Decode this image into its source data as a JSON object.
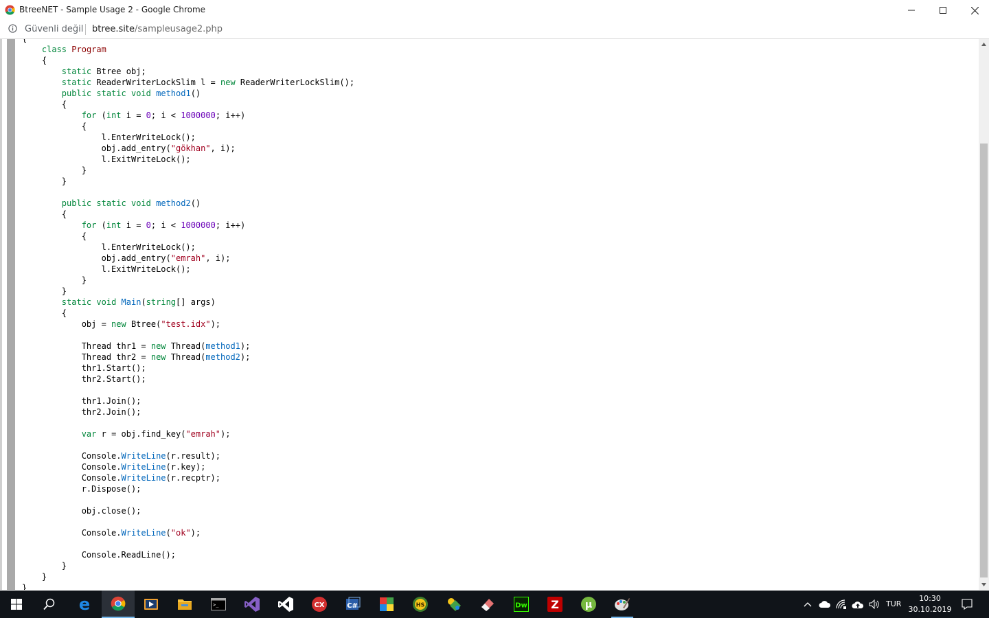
{
  "window": {
    "title": "BtreeNET - Sample Usage 2 - Google Chrome"
  },
  "address_bar": {
    "security_label": "Güvenli değil",
    "url_host": "btree.site",
    "url_path": "/sampleusage2.php"
  },
  "code_lines": [
    "{",
    "    class Program",
    "    {",
    "        static Btree obj;",
    "        static ReaderWriterLockSlim l = new ReaderWriterLockSlim();",
    "        public static void method1()",
    "        {",
    "            for (int i = 0; i < 1000000; i++)",
    "            {",
    "                l.EnterWriteLock();",
    "                obj.add_entry(\"gökhan\", i);",
    "                l.ExitWriteLock();",
    "            }",
    "        }",
    "",
    "        public static void method2()",
    "        {",
    "            for (int i = 0; i < 1000000; i++)",
    "            {",
    "                l.EnterWriteLock();",
    "                obj.add_entry(\"emrah\", i);",
    "                l.ExitWriteLock();",
    "            }",
    "        }",
    "        static void Main(string[] args)",
    "        {",
    "            obj = new Btree(\"test.idx\");",
    "",
    "            Thread thr1 = new Thread(method1);",
    "            Thread thr2 = new Thread(method2);",
    "            thr1.Start();",
    "            thr2.Start();",
    "",
    "            thr1.Join();",
    "            thr2.Join();",
    "",
    "            var r = obj.find_key(\"emrah\");",
    "",
    "            Console.WriteLine(r.result);",
    "            Console.WriteLine(r.key);",
    "            Console.WriteLine(r.recptr);",
    "            r.Dispose();",
    "",
    "            obj.close();",
    "",
    "            Console.WriteLine(\"ok\");",
    "",
    "            Console.ReadLine();",
    "        }",
    "    }",
    "}"
  ],
  "taskbar": {
    "apps": [
      {
        "icon": "start-icon",
        "active": false
      },
      {
        "icon": "search-icon",
        "active": false
      },
      {
        "icon": "edge-icon",
        "active": false
      },
      {
        "icon": "chrome-icon",
        "active": true
      },
      {
        "icon": "media-player-icon",
        "active": false
      },
      {
        "icon": "file-explorer-icon",
        "active": false
      },
      {
        "icon": "terminal-icon",
        "active": false
      },
      {
        "icon": "visual-studio-icon",
        "active": false
      },
      {
        "icon": "visual-studio-code-icon",
        "active": false
      },
      {
        "icon": "cx-icon",
        "active": false
      },
      {
        "icon": "csharp-icon",
        "active": false
      },
      {
        "icon": "mosaic-icon",
        "active": false
      },
      {
        "icon": "hs-icon",
        "active": false
      },
      {
        "icon": "tools-icon",
        "active": false
      },
      {
        "icon": "eraser-icon",
        "active": false
      },
      {
        "icon": "dreamweaver-icon",
        "active": false
      },
      {
        "icon": "filezilla-icon",
        "active": false
      },
      {
        "icon": "utorrent-icon",
        "active": false
      },
      {
        "icon": "paint-icon",
        "active": false
      }
    ],
    "language": "TUR",
    "time": "10:30",
    "date": "30.10.2019",
    "dreamweaver_label": "Dw",
    "cx_label": "CX",
    "hs_label": "HS"
  }
}
